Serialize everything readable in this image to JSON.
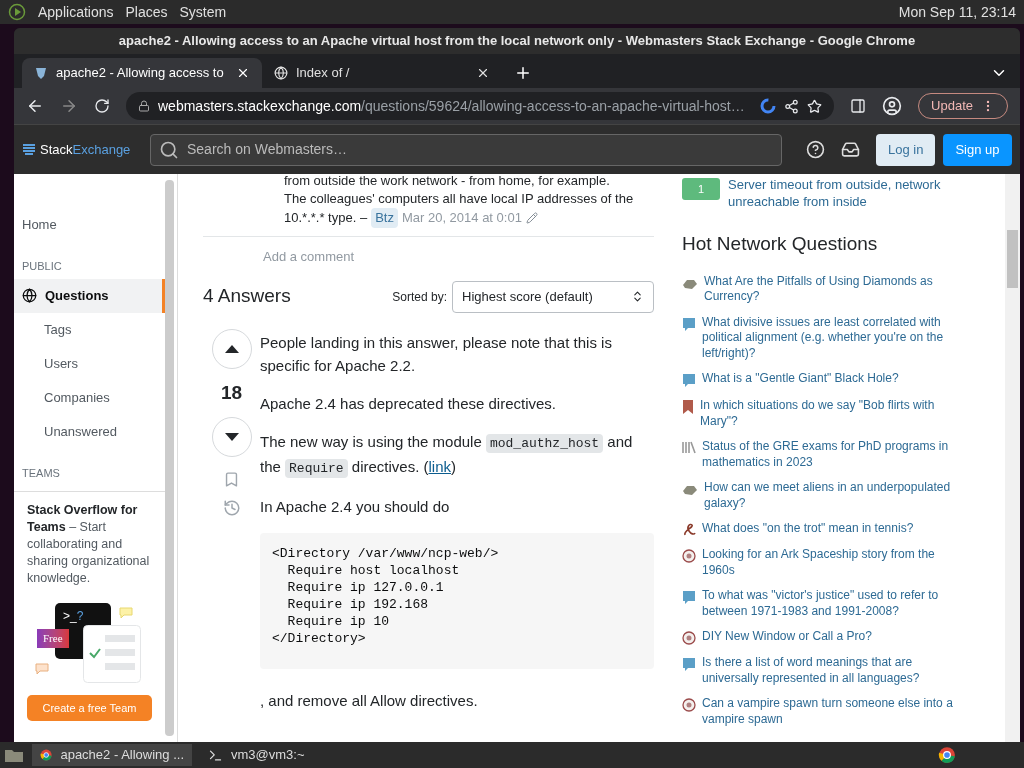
{
  "desktop_panel": {
    "menus": [
      "Applications",
      "Places",
      "System"
    ],
    "clock": "Mon Sep 11, 23:14"
  },
  "window": {
    "title": "apache2 - Allowing access to an Apache virtual host from the local network only - Webmasters Stack Exchange - Google Chrome"
  },
  "tabs": [
    {
      "label": "apache2 - Allowing access to",
      "selected": true
    },
    {
      "label": "Index of /",
      "selected": false
    }
  ],
  "address_bar": {
    "domain": "webmasters.stackexchange.com",
    "path": "/questions/59624/allowing-access-to-an-apache-virtual-host…"
  },
  "update_button": "Update",
  "site_header": {
    "logo_left": "Stack",
    "logo_right": "Exchange",
    "search_placeholder": "Search on Webmasters…",
    "login": "Log in",
    "signup": "Sign up"
  },
  "sidebar": [
    {
      "kind": "link",
      "label": "Home",
      "selected": false
    },
    {
      "kind": "heading",
      "label": "PUBLIC"
    },
    {
      "kind": "primary",
      "label": "Questions",
      "selected": true
    },
    {
      "kind": "sub",
      "label": "Tags",
      "selected": false
    },
    {
      "kind": "sub",
      "label": "Users",
      "selected": false
    },
    {
      "kind": "sub",
      "label": "Companies",
      "selected": false
    },
    {
      "kind": "sub",
      "label": "Unanswered",
      "selected": false
    },
    {
      "kind": "heading",
      "label": "TEAMS"
    }
  ],
  "teams_promo": {
    "text": "**Stack Overflow for Teams** – Start collaborating and sharing organizational knowledge.",
    "terminal": ">_?",
    "badge": "Free",
    "button": "Create a free Team"
  },
  "comment": {
    "lines": [
      "from outside the work network - from home, for example.",
      "The colleagues' computers all have local IP addresses of the"
    ],
    "tail": "10.*.*.* type. –",
    "user": "Btz",
    "time": "Mar 20, 2014 at 0:01"
  },
  "add_comment": "Add a comment",
  "answers": {
    "count_label": "4 Answers",
    "sort_label": "Sorted by:",
    "sort_value": "Highest score (default)"
  },
  "answer": {
    "score": "18",
    "blocks": [
      {
        "kind": "para",
        "parts": [
          {
            "kind": "text",
            "text": "People landing in this answer, please note that this is specific for Apache 2.2."
          }
        ]
      },
      {
        "kind": "para",
        "parts": [
          {
            "kind": "text",
            "text": "Apache 2.4 has deprecated these directives."
          }
        ]
      },
      {
        "kind": "para",
        "parts": [
          {
            "kind": "text",
            "text": "The new way is using the module "
          },
          {
            "kind": "code",
            "text": "mod_authz_host"
          },
          {
            "kind": "text",
            "text": " and the "
          },
          {
            "kind": "code",
            "text": "Require"
          },
          {
            "kind": "text",
            "text": " directives. ("
          },
          {
            "kind": "link",
            "text": "link"
          },
          {
            "kind": "text",
            "text": ")"
          }
        ]
      },
      {
        "kind": "para",
        "parts": [
          {
            "kind": "text",
            "text": "In Apache 2.4 you should do"
          }
        ]
      },
      {
        "kind": "codeblock",
        "lines": [
          "<Directory /var/www/ncp-web/>",
          "  Require host localhost",
          "  Require ip 127.0.0.1",
          "  Require ip 192.168",
          "  Require ip 10",
          "</Directory>"
        ]
      },
      {
        "kind": "para",
        "parts": [
          {
            "kind": "text",
            "text": ", and remove all Allow directives."
          }
        ]
      }
    ]
  },
  "related": [
    {
      "score": "1",
      "title": "Server timeout from outside, network unreachable from inside"
    }
  ],
  "hot_network": {
    "title": "Hot Network Questions",
    "items": [
      "What Are the Pitfalls of Using Diamonds as Currency?",
      "What divisive issues are least correlated with political alignment (e.g. whether you're on the left/right)?",
      "What is a \"Gentle Giant\" Black Hole?",
      "In which situations do we say \"Bob flirts with Mary\"?",
      "Status of the GRE exams for PhD programs in mathematics in 2023",
      "How can we meet aliens in an underpopulated galaxy?",
      "What does \"on the trot\" mean in tennis?",
      "Looking for an Ark Spaceship story from the 1960s",
      "To what was \"victor's justice\" used to refer to between 1971-1983 and 1991-2008?",
      "DIY New Window or Call a Pro?",
      "Is there a list of word meanings that are universally represented in all languages?",
      "Can a vampire spawn turn someone else into a vampire spawn"
    ]
  },
  "taskbar": [
    {
      "label": "apache2 - Allowing ...",
      "selected": true
    },
    {
      "label": "vm3@vm3:~",
      "selected": false
    }
  ]
}
